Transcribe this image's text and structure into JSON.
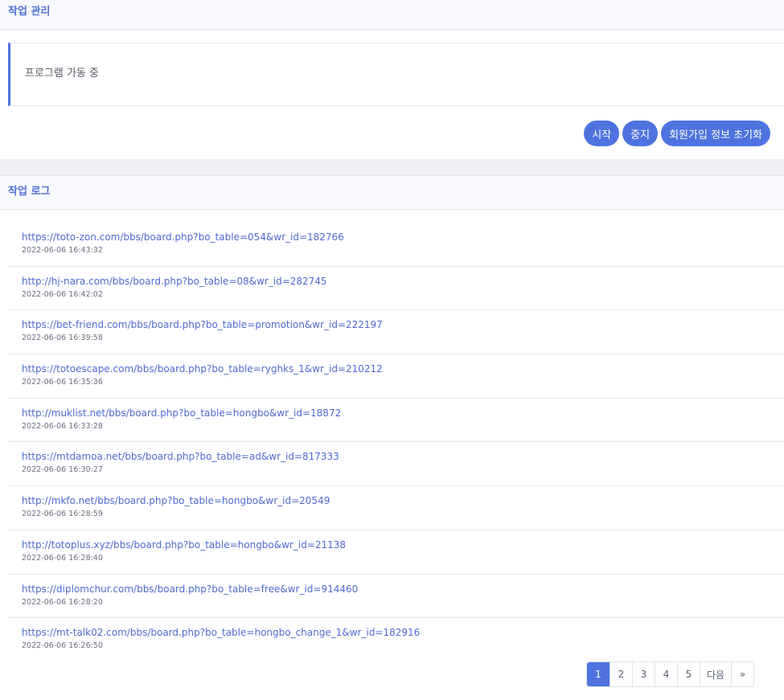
{
  "task_panel": {
    "title": "작업 관리",
    "status_text": "프로그램 가동 중",
    "buttons": {
      "start": "시작",
      "stop": "중지",
      "reset": "회원가입 정보 초기화"
    }
  },
  "log_panel": {
    "title": "작업 로그",
    "entries": [
      {
        "url": "https://toto-zon.com/bbs/board.php?bo_table=054&wr_id=182766",
        "time": "2022-06-06 16:43:32"
      },
      {
        "url": "http://hj-nara.com/bbs/board.php?bo_table=08&wr_id=282745",
        "time": "2022-06-06 16:42:02"
      },
      {
        "url": "https://bet-friend.com/bbs/board.php?bo_table=promotion&wr_id=222197",
        "time": "2022-06-06 16:39:58"
      },
      {
        "url": "https://totoescape.com/bbs/board.php?bo_table=ryghks_1&wr_id=210212",
        "time": "2022-06-06 16:35:36"
      },
      {
        "url": "http://muklist.net/bbs/board.php?bo_table=hongbo&wr_id=18872",
        "time": "2022-06-06 16:33:28"
      },
      {
        "url": "https://mtdamoa.net/bbs/board.php?bo_table=ad&wr_id=817333",
        "time": "2022-06-06 16:30:27"
      },
      {
        "url": "http://mkfo.net/bbs/board.php?bo_table=hongbo&wr_id=20549",
        "time": "2022-06-06 16:28:59"
      },
      {
        "url": "http://totoplus.xyz/bbs/board.php?bo_table=hongbo&wr_id=21138",
        "time": "2022-06-06 16:28:40"
      },
      {
        "url": "https://diplomchur.com/bbs/board.php?bo_table=free&wr_id=914460",
        "time": "2022-06-06 16:28:20"
      },
      {
        "url": "https://mt-talk02.com/bbs/board.php?bo_table=hongbo_change_1&wr_id=182916",
        "time": "2022-06-06 16:26:50"
      }
    ]
  },
  "pagination": {
    "pages": [
      "1",
      "2",
      "3",
      "4",
      "5"
    ],
    "current": "1",
    "next_label": "다음",
    "last_label": "»"
  }
}
